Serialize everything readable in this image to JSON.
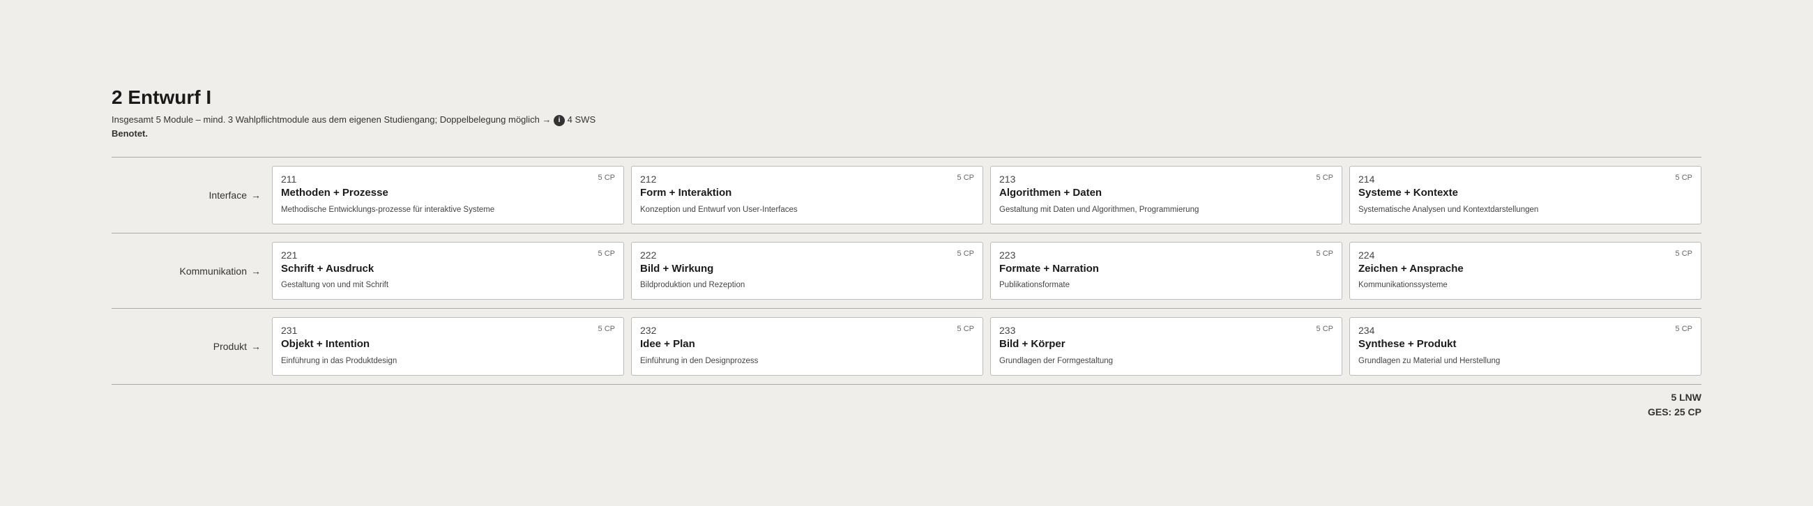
{
  "header": {
    "title": "2 Entwurf I",
    "subtitle": "Insgesamt 5 Module – mind. 3 Wahlpflichtmodule aus dem eigenen Studiengang; Doppelbelegung möglich →",
    "info_icon": "i",
    "sws": "4 SWS",
    "grade_label": "Benotet."
  },
  "rows": [
    {
      "label": "Interface",
      "cards": [
        {
          "number": "211",
          "cp": "5 CP",
          "title": "Methoden + Prozesse",
          "desc": "Methodische Entwicklungs-prozesse für interaktive Systeme"
        },
        {
          "number": "212",
          "cp": "5 CP",
          "title": "Form + Interaktion",
          "desc": "Konzeption und Entwurf von User-Interfaces"
        },
        {
          "number": "213",
          "cp": "5 CP",
          "title": "Algorithmen + Daten",
          "desc": "Gestaltung mit Daten und Algorithmen, Programmierung"
        },
        {
          "number": "214",
          "cp": "5 CP",
          "title": "Systeme + Kontexte",
          "desc": "Systematische Analysen und Kontextdarstellungen"
        }
      ]
    },
    {
      "label": "Kommunikation",
      "cards": [
        {
          "number": "221",
          "cp": "5 CP",
          "title": "Schrift + Ausdruck",
          "desc": "Gestaltung von und mit Schrift"
        },
        {
          "number": "222",
          "cp": "5 CP",
          "title": "Bild + Wirkung",
          "desc": "Bildproduktion und Rezeption"
        },
        {
          "number": "223",
          "cp": "5 CP",
          "title": "Formate + Narration",
          "desc": "Publikationsformate"
        },
        {
          "number": "224",
          "cp": "5 CP",
          "title": "Zeichen + Ansprache",
          "desc": "Kommunikationssysteme"
        }
      ]
    },
    {
      "label": "Produkt",
      "cards": [
        {
          "number": "231",
          "cp": "5 CP",
          "title": "Objekt + Intention",
          "desc": "Einführung in das Produktdesign"
        },
        {
          "number": "232",
          "cp": "5 CP",
          "title": "Idee + Plan",
          "desc": "Einführung in den Designprozess"
        },
        {
          "number": "233",
          "cp": "5 CP",
          "title": "Bild + Körper",
          "desc": "Grundlagen der Formgestaltung"
        },
        {
          "number": "234",
          "cp": "5 CP",
          "title": "Synthese + Produkt",
          "desc": "Grundlagen zu Material und Herstellung"
        }
      ]
    }
  ],
  "footer": {
    "lnw": "5 LNW",
    "ges": "GES: 25 CP"
  }
}
